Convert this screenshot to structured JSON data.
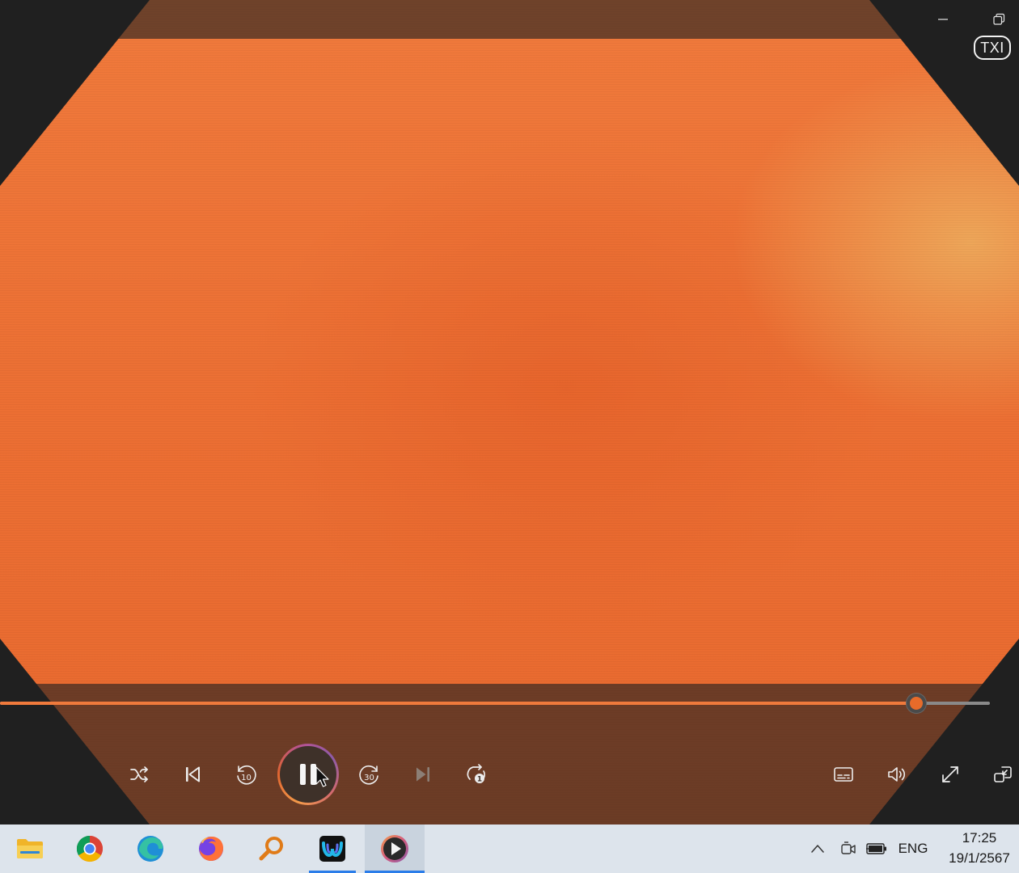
{
  "window": {
    "logo_text": "TXI",
    "controls": [
      "minimize",
      "restore"
    ]
  },
  "video": {
    "dominant_color": "#ec6f33",
    "highlight_color": "#eeaf5f"
  },
  "seek_bar": {
    "progress_fraction": 0.926,
    "fill_color": "#f07a3c",
    "track_color": "#8a8a8a"
  },
  "controls": {
    "shuffle": "shuffle-icon",
    "previous": "skip-previous-icon",
    "rewind": {
      "icon": "rewind-icon",
      "label": "10"
    },
    "play_pause": {
      "icon": "pause-icon",
      "state": "playing"
    },
    "forward": {
      "icon": "fast-forward-icon",
      "label": "30"
    },
    "next": {
      "icon": "skip-next-icon",
      "enabled": false
    },
    "repeat": {
      "icon": "repeat-one-icon",
      "label": "1"
    },
    "subtitles": "subtitles-icon",
    "volume": "volume-icon",
    "fullscreen": "fullscreen-icon",
    "mini_player": "mini-player-icon"
  },
  "taskbar": {
    "apps": [
      {
        "name": "file-explorer",
        "active": false
      },
      {
        "name": "chrome",
        "active": false
      },
      {
        "name": "edge",
        "active": false
      },
      {
        "name": "firefox",
        "active": false
      },
      {
        "name": "search-tool",
        "active": false
      },
      {
        "name": "webex",
        "active": false,
        "running": true
      },
      {
        "name": "media-player",
        "active": true,
        "running": true
      }
    ],
    "tray": {
      "language": "ENG",
      "time": "17:25",
      "date": "19/1/2567"
    },
    "accent_color": "#2b7de9"
  }
}
